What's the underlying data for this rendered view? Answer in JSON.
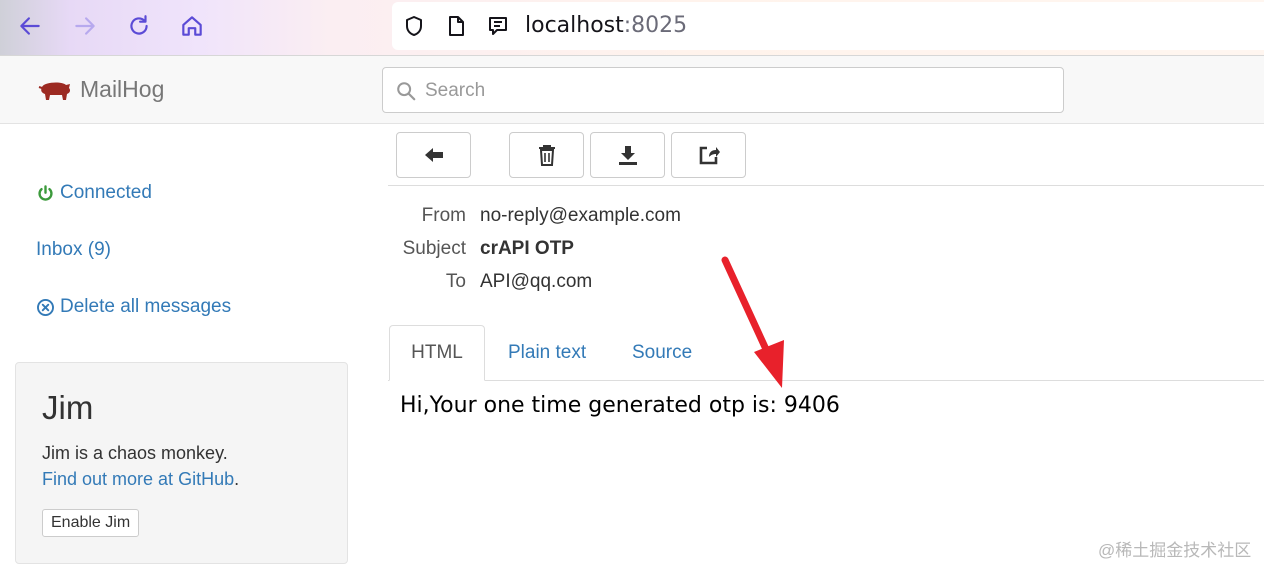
{
  "browser": {
    "url_host": "localhost",
    "url_port": ":8025",
    "icons": [
      "back-arrow-icon",
      "forward-arrow-icon",
      "reload-icon",
      "home-icon",
      "shield-icon",
      "page-icon",
      "reader-view-icon"
    ]
  },
  "header": {
    "brand": "MailHog",
    "search_placeholder": "Search"
  },
  "sidebar": {
    "status": "Connected",
    "inbox": "Inbox (9)",
    "delete_all": "Delete all messages"
  },
  "jim": {
    "title": "Jim",
    "description": "Jim is a chaos monkey.",
    "link_text": "Find out more at GitHub",
    "link_suffix": ".",
    "button": "Enable Jim"
  },
  "message": {
    "headers": [
      {
        "label": "From",
        "value": "no-reply@example.com"
      },
      {
        "label": "Subject",
        "value": "crAPI OTP"
      },
      {
        "label": "To",
        "value": "API@qq.com"
      }
    ],
    "tabs": [
      {
        "label": "HTML",
        "active": true
      },
      {
        "label": "Plain text",
        "active": false
      },
      {
        "label": "Source",
        "active": false
      }
    ],
    "body": "Hi,Your one time generated otp is: 9406"
  },
  "watermark": "@稀土掘金技术社区",
  "colors": {
    "link": "#337ab7",
    "connected": "#3c9a3c",
    "annotation_arrow": "#e8212b"
  }
}
